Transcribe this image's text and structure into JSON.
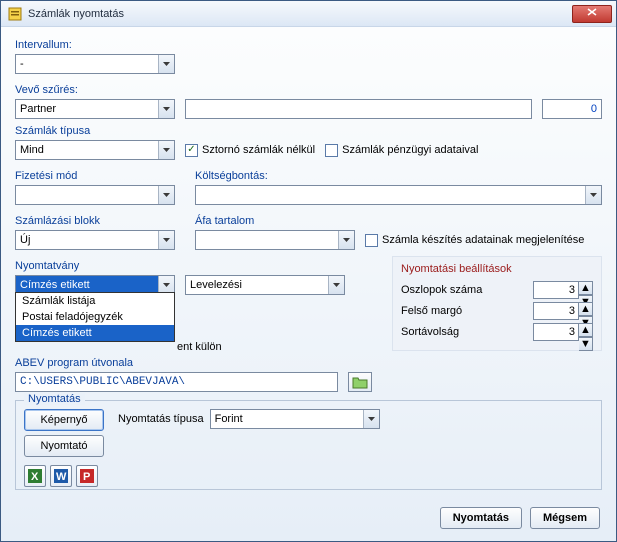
{
  "window": {
    "title": "Számlák nyomtatás"
  },
  "intervallum": {
    "label": "Intervallum:",
    "value": "-"
  },
  "vevo": {
    "label": "Vevő szűrés:",
    "partner_value": "Partner",
    "text_value": "",
    "count": 0
  },
  "szamlatipus": {
    "label": "Számlák típusa",
    "value": "Mind",
    "storno_label": "Sztornó számlák nélkül",
    "storno_checked": true,
    "penzugyi_label": "Számlák pénzügyi adataival",
    "penzugyi_checked": false
  },
  "fizmod": {
    "label": "Fizetési mód",
    "value": ""
  },
  "koltseg": {
    "label": "Költségbontás:",
    "value": ""
  },
  "blokk": {
    "label": "Számlázási blokk",
    "value": "Új"
  },
  "afa": {
    "label": "Áfa tartalom",
    "value": "",
    "megjel_label": "Számla készítés adatainak megjelenítése",
    "megjel_checked": false
  },
  "nyomtatvany": {
    "label": "Nyomtatvány",
    "value": "Címzés etikett",
    "options": [
      "Számlák listája",
      "Postai feladójegyzék",
      "Címzés etikett"
    ],
    "selected_index": 2,
    "sub_value": "Levelezési",
    "truncated_text": "ent külön"
  },
  "abev": {
    "label": "ABEV program útvonala",
    "path": "C:\\USERS\\PUBLIC\\ABEVJAVA\\"
  },
  "beallitasok": {
    "title": "Nyomtatási beállítások",
    "oszlopok_label": "Oszlopok száma",
    "oszlopok_value": 3,
    "margo_label": "Felső margó",
    "margo_value": 3,
    "sor_label": "Sortávolság",
    "sor_value": 3
  },
  "nyomtatas_group": {
    "legend": "Nyomtatás",
    "kepernyo": "Képernyő",
    "nyomtato": "Nyomtató",
    "tipus_label": "Nyomtatás típusa",
    "tipus_value": "Forint"
  },
  "footer": {
    "print": "Nyomtatás",
    "cancel": "Mégsem"
  }
}
